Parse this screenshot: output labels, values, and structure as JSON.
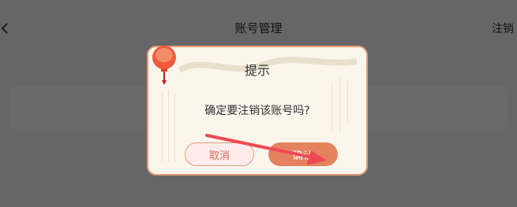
{
  "header": {
    "title": "账号管理",
    "right_action": "注销"
  },
  "dialog": {
    "title": "提示",
    "message": "确定要注销该账号吗?",
    "cancel_label": "取消",
    "confirm_label": "确认"
  },
  "colors": {
    "accent": "#e5825e",
    "overlay": "#666666",
    "annotation_arrow": "#ee4a55"
  },
  "icons": {
    "back": "chevron-left-icon",
    "decoration": "lantern-icon"
  }
}
